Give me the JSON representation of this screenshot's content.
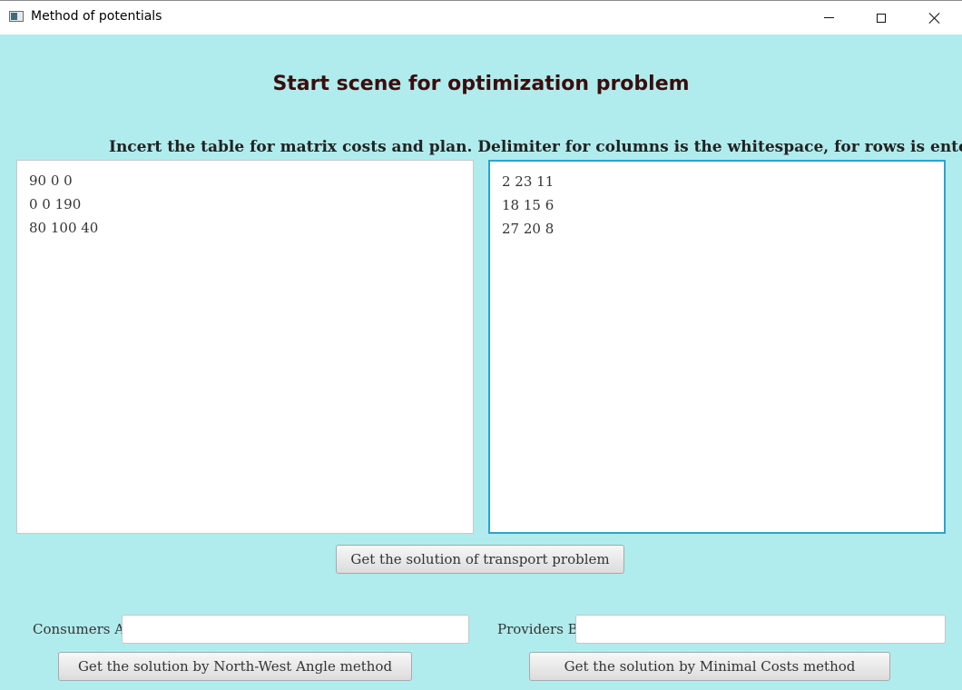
{
  "window": {
    "title": "Method of potentials",
    "controls": [
      "minimize-icon",
      "maximize-icon",
      "close-icon"
    ]
  },
  "heading": "Start scene for optimization problem",
  "instruction": "Incert the table for matrix costs and plan. Delimiter for columns is the whitespace, for rows is enter",
  "left_textarea": {
    "lines": [
      "90 0 0",
      "0 0 190",
      "80 100 40"
    ]
  },
  "right_textarea": {
    "lines": [
      "2 23 11",
      "18 15 6",
      "27 20 8"
    ]
  },
  "buttons": {
    "solve": "Get the solution of transport problem",
    "north_west": "Get the solution by North-West Angle method",
    "minimal_costs": "Get the solution by Minimal Costs method"
  },
  "fields": {
    "consumers_label": "Consumers A",
    "consumers_value": "",
    "providers_label": "Providers B",
    "providers_value": ""
  },
  "colors": {
    "background": "#b0eced",
    "heading": "#3b0d0d",
    "focus_border": "#2aa4cf"
  }
}
